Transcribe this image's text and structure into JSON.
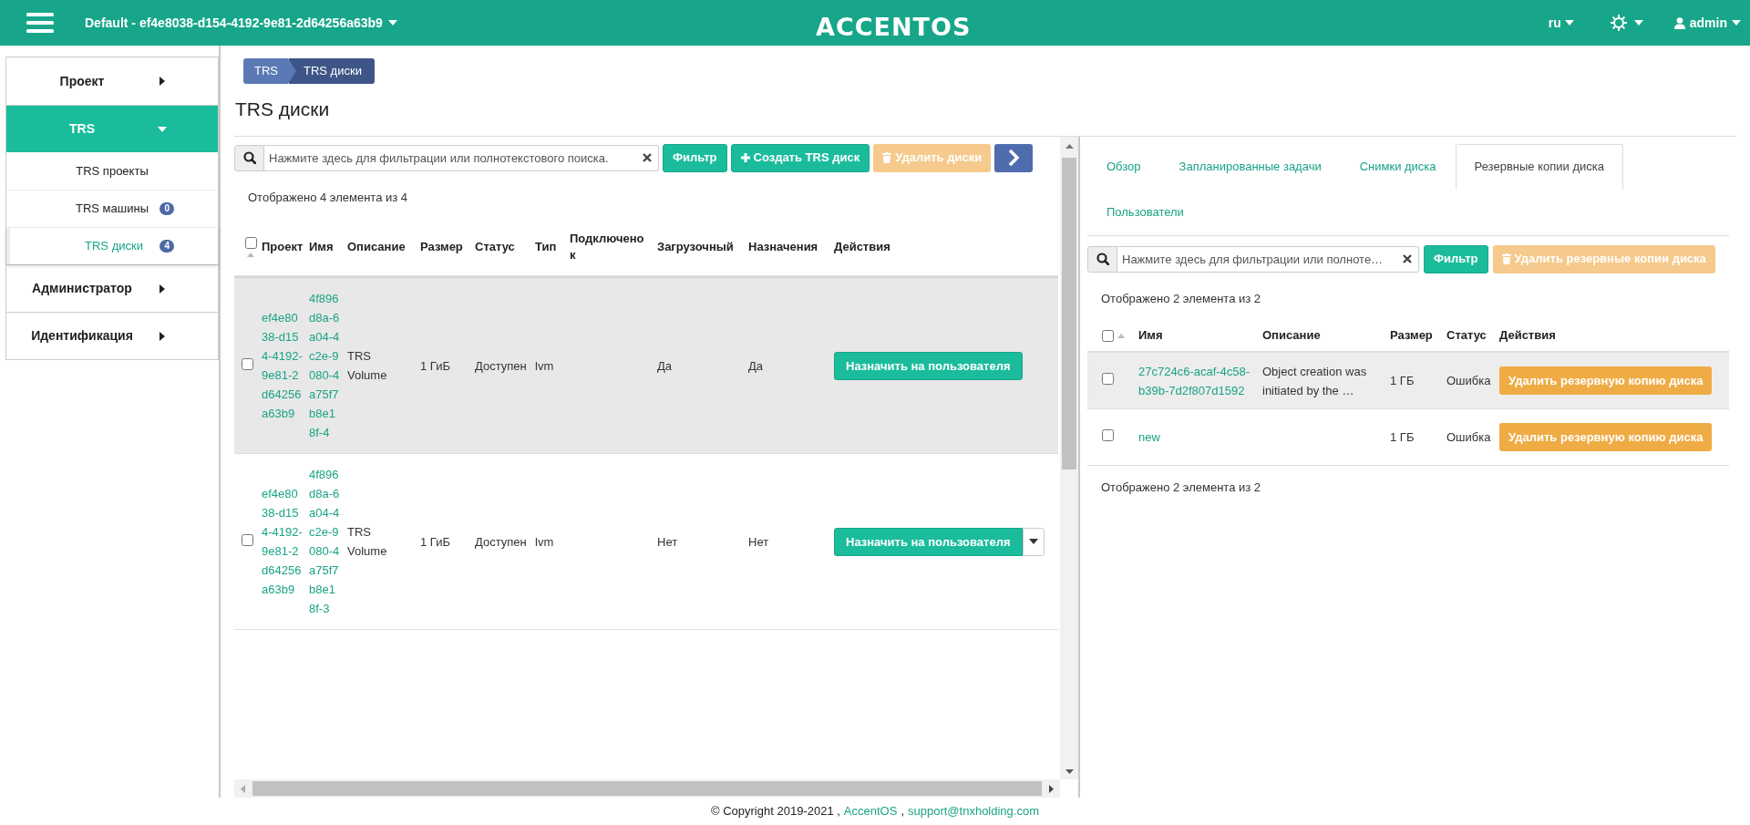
{
  "header": {
    "project_selector": "Default - ef4e8038-d154-4192-9e81-2d64256a63b9",
    "logo": "ACCENTOS",
    "language": "ru",
    "user": "admin"
  },
  "sidebar": {
    "sections": [
      {
        "label": "Проект",
        "expanded": false,
        "selected": false
      },
      {
        "label": "TRS",
        "expanded": true,
        "selected": true,
        "children": [
          {
            "label": "TRS проекты",
            "selected": false
          },
          {
            "label": "TRS машины",
            "badge": "0",
            "selected": false
          },
          {
            "label": "TRS диски",
            "badge": "4",
            "selected": true
          }
        ]
      },
      {
        "label": "Администратор",
        "expanded": false,
        "selected": false
      },
      {
        "label": "Идентификация",
        "expanded": false,
        "selected": false
      }
    ]
  },
  "breadcrumb": [
    "TRS",
    "TRS диски"
  ],
  "page_title": "TRS диски",
  "volumes": {
    "search": {
      "placeholder": "Нажмите здесь для фильтрации или полнотекстового поиска."
    },
    "buttons": [
      {
        "kind": "filter",
        "label": "Фильтр",
        "disabled": false
      },
      {
        "kind": "create",
        "label": "Создать TRS диск",
        "disabled": false
      },
      {
        "kind": "delete",
        "label": "Удалить диски",
        "disabled": true
      },
      {
        "kind": "next",
        "disabled": false
      }
    ],
    "count": "Отображено 4 элемента из 4",
    "select_all": {
      "checked": false
    },
    "columns": [
      "Проект",
      "Имя",
      "Описание",
      "Размер",
      "Статус",
      "Тип",
      "Подключено к",
      "Загрузочный",
      "Назначения",
      "Действия"
    ],
    "rows": [
      {
        "checked": false,
        "hovered": true,
        "project": "ef4e8038-d154-4192-9e81-2d64256a63b9",
        "name": "4f896d8a-6a04-4c2e-9080-4a75f7b8e18f-4",
        "description": "TRS Volume",
        "size": "1 ГиБ",
        "status": "Доступен",
        "type": "lvm",
        "bootable": "Да",
        "assignments": "Да",
        "action": "Назначить на пользователя",
        "has_menu": false
      },
      {
        "checked": false,
        "hovered": false,
        "project": "ef4e8038-d154-4192-9e81-2d64256a63b9",
        "name": "4f896d8a-6a04-4c2e-9080-4a75f7b8e18f-3",
        "description": "TRS Volume",
        "size": "1 ГиБ",
        "status": "Доступен",
        "type": "lvm",
        "bootable": "Нет",
        "assignments": "Нет",
        "action": "Назначить на пользователя",
        "has_menu": true
      }
    ]
  },
  "detail": {
    "tabs": [
      {
        "label": "Обзор",
        "selected": false
      },
      {
        "label": "Запланированные задачи",
        "selected": false
      },
      {
        "label": "Снимки диска",
        "selected": false
      },
      {
        "label": "Резервные копии диска",
        "selected": true
      },
      {
        "label": "Пользователи",
        "selected": false
      }
    ],
    "search": {
      "placeholder": "Нажмите здесь для фильтрации или полноте…"
    },
    "buttons": [
      {
        "kind": "filter",
        "label": "Фильтр",
        "disabled": false
      },
      {
        "kind": "delete",
        "label": "Удалить резервные копии диска",
        "disabled": true
      }
    ],
    "count_top": "Отображено 2 элемента из 2",
    "select_all": {
      "checked": false
    },
    "columns": [
      "Имя",
      "Описание",
      "Размер",
      "Статус",
      "Действия"
    ],
    "rows": [
      {
        "checked": false,
        "hovered": true,
        "name": "27c724c6-acaf-4c58-b39b-7d2f807d1592",
        "description": "Object creation was initiated by the …",
        "size": "1 ГБ",
        "status": "Ошибка",
        "action": "Удалить резервную копию диска"
      },
      {
        "checked": false,
        "hovered": false,
        "name": "new",
        "size": "1 ГБ",
        "status": "Ошибка",
        "action": "Удалить резервную копию диска"
      }
    ],
    "count_bottom": "Отображено 2 элемента из 2"
  },
  "footer": [
    {
      "kind": "text",
      "text": "© Copyright 2019-2021 ,"
    },
    {
      "kind": "link",
      "text": "AccentOS"
    },
    {
      "kind": "text",
      "text": ","
    },
    {
      "kind": "link",
      "text": "support@tnxholding.com"
    }
  ]
}
